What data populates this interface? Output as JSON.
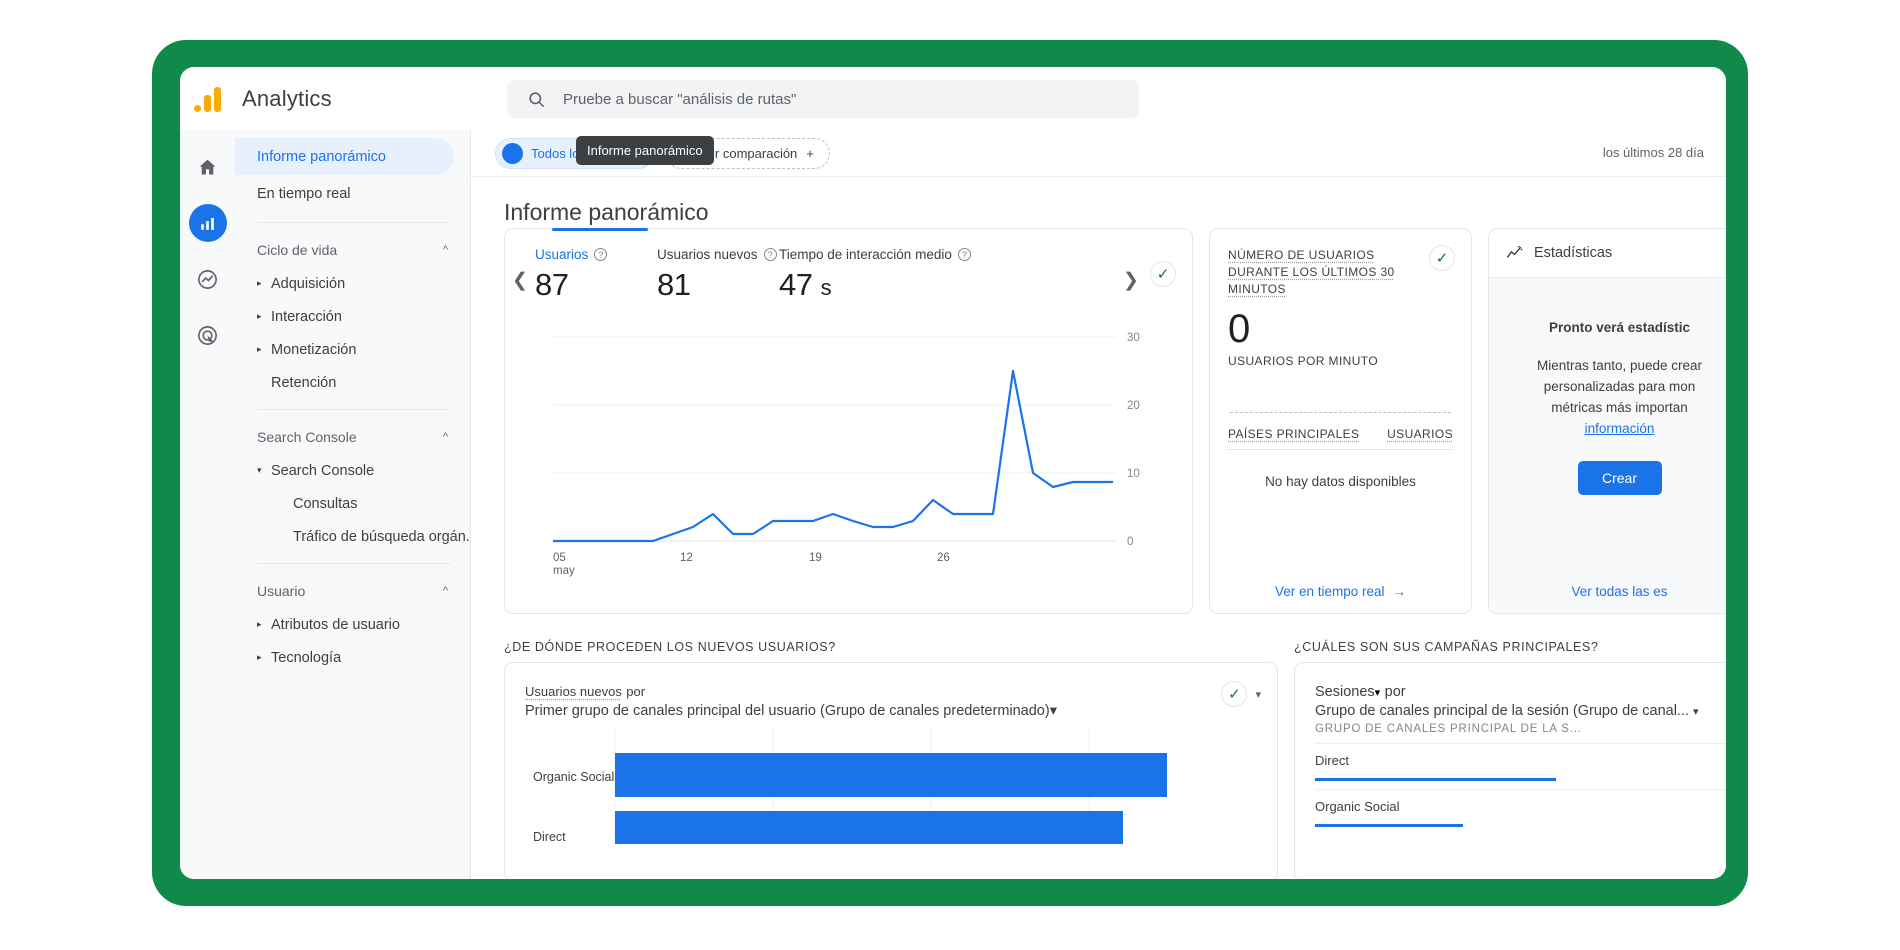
{
  "app": {
    "brand": "Analytics",
    "logo_colors": [
      "#f9ab00",
      "#e37400"
    ]
  },
  "search": {
    "placeholder": "Pruebe a buscar \"análisis de rutas\"",
    "icon": "search-icon"
  },
  "rail": {
    "items": [
      {
        "name": "home-icon",
        "label": "Inicio",
        "active": false
      },
      {
        "name": "reports-icon",
        "label": "Informes",
        "active": true
      },
      {
        "name": "explore-icon",
        "label": "Explorar",
        "active": false
      },
      {
        "name": "advertising-icon",
        "label": "Publicidad",
        "active": false
      }
    ]
  },
  "sidebar": {
    "top_items": [
      {
        "label": "Informe panorámico",
        "selected": true
      },
      {
        "label": "En tiempo real",
        "selected": false
      }
    ],
    "groups": [
      {
        "title": "Ciclo de vida",
        "collapse_icon": "chevron-up-icon",
        "items": [
          {
            "label": "Adquisición",
            "expandable": true,
            "expanded": false
          },
          {
            "label": "Interacción",
            "expandable": true,
            "expanded": false
          },
          {
            "label": "Monetización",
            "expandable": true,
            "expanded": false
          },
          {
            "label": "Retención",
            "expandable": false,
            "expanded": false
          }
        ]
      },
      {
        "title": "Search Console",
        "collapse_icon": "chevron-up-icon",
        "items": [
          {
            "label": "Search Console",
            "expandable": true,
            "expanded": true
          }
        ],
        "leaves": [
          "Consultas",
          "Tráfico de búsqueda orgán..."
        ]
      },
      {
        "title": "Usuario",
        "collapse_icon": "chevron-up-icon",
        "items": [
          {
            "label": "Atributos de usuario",
            "expandable": true,
            "expanded": false
          },
          {
            "label": "Tecnología",
            "expandable": true,
            "expanded": false
          }
        ]
      }
    ]
  },
  "tooltip": {
    "text": "Informe panorámico"
  },
  "subbar": {
    "segment_chip": "Todos los usuarios",
    "add_comparison": "Añadir comparación",
    "add_icon": "plus-icon",
    "date_range": "los últimos 28 día"
  },
  "page": {
    "title": "Informe panorámico"
  },
  "metrics_card": {
    "prev_icon": "chevron-left-icon",
    "next_icon": "chevron-right-icon",
    "status_icon": "check-circle-icon",
    "metrics": [
      {
        "label": "Usuarios",
        "value": "87",
        "unit": "",
        "active": true,
        "help_icon": "help-icon"
      },
      {
        "label": "Usuarios nuevos",
        "value": "81",
        "unit": "",
        "active": false,
        "help_icon": "help-icon"
      },
      {
        "label": "Tiempo de interacción medio",
        "value": "47",
        "unit": "s",
        "active": false,
        "help_icon": "help-icon"
      }
    ]
  },
  "chart_data": {
    "type": "line",
    "title": "Usuarios",
    "xlabel": "",
    "ylabel": "",
    "ylim": [
      0,
      30
    ],
    "yticks": [
      0,
      10,
      20,
      30
    ],
    "grid": true,
    "series_color": "#1a73e8",
    "x_tick_labels": [
      {
        "label": "05",
        "sub": "may"
      },
      {
        "label": "12",
        "sub": ""
      },
      {
        "label": "19",
        "sub": ""
      },
      {
        "label": "26",
        "sub": ""
      }
    ],
    "x": [
      1,
      2,
      3,
      4,
      5,
      6,
      7,
      8,
      9,
      10,
      11,
      12,
      13,
      14,
      15,
      16,
      17,
      18,
      19,
      20,
      21,
      22,
      23,
      24,
      25,
      26,
      27,
      28
    ],
    "values": [
      0,
      0,
      0,
      0,
      0,
      0,
      0,
      1,
      2,
      4,
      1,
      1,
      3,
      3,
      3,
      4,
      3,
      2,
      2,
      3,
      6,
      4,
      4,
      4,
      25,
      10,
      7,
      8
    ]
  },
  "realtime_card": {
    "title": "NÚMERO DE USUARIOS DURANTE LOS ÚLTIMOS 30 MINUTOS",
    "status_icon": "check-circle-icon",
    "value": "0",
    "subtitle": "USUARIOS POR MINUTO",
    "table_headers": [
      "PAÍSES PRINCIPALES",
      "USUARIOS"
    ],
    "empty_text": "No hay datos disponibles",
    "link": "Ver en tiempo real",
    "link_icon": "arrow-right-icon"
  },
  "insights_card": {
    "header": "Estadísticas",
    "header_icon": "insights-icon",
    "title": "Pronto verá estadístic",
    "body_lines": [
      "Mientras tanto, puede crear",
      "personalizadas para mon",
      "métricas más importan"
    ],
    "link": "información",
    "button": "Crear",
    "footer_link": "Ver todas las es"
  },
  "bottom_left_card": {
    "section_title": "¿DE DÓNDE PROCEDEN LOS NUEVOS USUARIOS?",
    "metric": "Usuarios nuevos",
    "connector": "por",
    "dimension": "Primer grupo de canales principal del usuario (Grupo de canales predeterminado)",
    "dropdown_icon": "chevron-down-icon",
    "status_icon": "check-circle-icon",
    "kebab_icon": "chevron-down-icon",
    "chart": {
      "type": "bar",
      "orientation": "horizontal",
      "categories": [
        "Organic Social",
        "Direct"
      ],
      "values": [
        100,
        92
      ],
      "color": "#1a73e8",
      "gridlines": 3
    }
  },
  "bottom_right_card": {
    "section_title": "¿CUÁLES SON SUS CAMPAÑAS PRINCIPALES?",
    "metric": "Sesiones",
    "metric_dropdown_icon": "chevron-down-icon",
    "connector": "por",
    "dimension": "Grupo de canales principal de la sesión (Grupo de canal...",
    "dropdown_icon": "chevron-down-icon",
    "column_header": "GRUPO DE CANALES PRINCIPAL DE LA S...",
    "rows": [
      {
        "name": "Direct",
        "bar_pct": 57
      },
      {
        "name": "Organic Social",
        "bar_pct": 35
      }
    ],
    "bar_color": "#1a73e8"
  },
  "colors": {
    "frame_green": "#0f8a4a",
    "accent_blue": "#1a73e8",
    "check_green": "#137333",
    "sidebar_bg": "#f8f9fa"
  }
}
